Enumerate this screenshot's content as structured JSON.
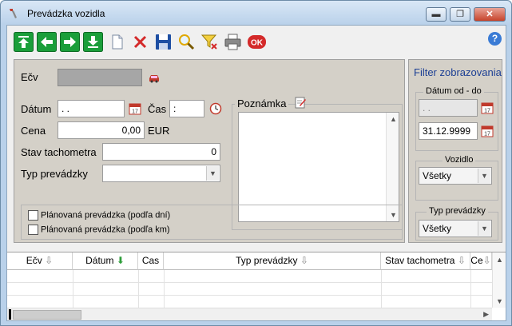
{
  "window": {
    "title": "Prevádzka vozidla",
    "controls": {
      "minimize": "▬",
      "maximize": "❐",
      "close": "✕"
    }
  },
  "toolbar": {
    "buttons": [
      {
        "name": "first-record-button",
        "icon": "arrow-up-to-top-icon",
        "color": "#1a9e3a"
      },
      {
        "name": "previous-record-button",
        "icon": "arrow-left-icon",
        "color": "#1a9e3a"
      },
      {
        "name": "next-record-button",
        "icon": "arrow-right-icon",
        "color": "#1a9e3a"
      },
      {
        "name": "last-record-button",
        "icon": "arrow-down-to-bottom-icon",
        "color": "#1a9e3a"
      },
      {
        "name": "new-record-button",
        "icon": "new-document-icon"
      },
      {
        "name": "delete-record-button",
        "icon": "delete-x-icon",
        "color": "#d42a2a"
      },
      {
        "name": "save-button",
        "icon": "floppy-disk-icon",
        "color": "#1e4fa3"
      },
      {
        "name": "search-button",
        "icon": "magnifier-icon"
      },
      {
        "name": "clear-filter-button",
        "icon": "filter-clear-icon"
      },
      {
        "name": "print-button",
        "icon": "printer-icon"
      },
      {
        "name": "ok-button",
        "icon": "ok-icon",
        "label": "OK",
        "color": "#d42a2a"
      }
    ],
    "help": "?"
  },
  "form": {
    "ecv_label": "Ečv",
    "datum_label": "Dátum",
    "datum_value": " .  .",
    "cas_label": "Čas",
    "cas_value": ":",
    "cena_label": "Cena",
    "cena_value": "0,00",
    "cena_unit": "EUR",
    "stav_label": "Stav tachometra",
    "stav_value": "0",
    "typ_label": "Typ prevádzky",
    "typ_value": "",
    "poznamka_label": "Poznámka",
    "check_dni": "Plánovaná prevádzka (podľa dní)",
    "check_km": "Plánovaná prevádzka (podľa km)"
  },
  "filter": {
    "title": "Filter zobrazovania",
    "datum_group": "Dátum od - do",
    "date_from": " .  .",
    "date_to": "31.12.9999",
    "vozidlo_group": "Vozidlo",
    "vozidlo_value": "Všetky",
    "typ_group": "Typ prevádzky",
    "typ_value": "Všetky"
  },
  "grid": {
    "columns": [
      "Ečv",
      "Dátum",
      "Cas",
      "Typ prevádzky",
      "Stav tachometra",
      "Ce"
    ],
    "sort_arrows": [
      "⇩",
      "⬇",
      "",
      "⇩",
      "⇩",
      "⇩"
    ],
    "rows": 3
  }
}
